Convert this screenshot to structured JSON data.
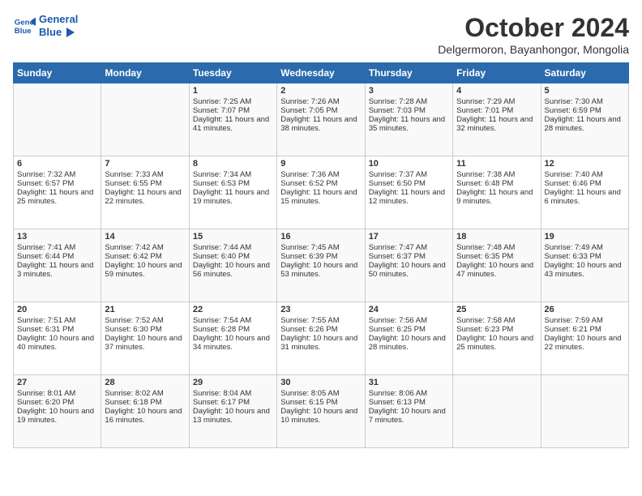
{
  "header": {
    "logo_line1": "General",
    "logo_line2": "Blue",
    "title": "October 2024",
    "location": "Delgermoron, Bayanhongor, Mongolia"
  },
  "weekdays": [
    "Sunday",
    "Monday",
    "Tuesday",
    "Wednesday",
    "Thursday",
    "Friday",
    "Saturday"
  ],
  "weeks": [
    [
      {
        "day": "",
        "info": ""
      },
      {
        "day": "",
        "info": ""
      },
      {
        "day": "1",
        "info": "Sunrise: 7:25 AM\nSunset: 7:07 PM\nDaylight: 11 hours and 41 minutes."
      },
      {
        "day": "2",
        "info": "Sunrise: 7:26 AM\nSunset: 7:05 PM\nDaylight: 11 hours and 38 minutes."
      },
      {
        "day": "3",
        "info": "Sunrise: 7:28 AM\nSunset: 7:03 PM\nDaylight: 11 hours and 35 minutes."
      },
      {
        "day": "4",
        "info": "Sunrise: 7:29 AM\nSunset: 7:01 PM\nDaylight: 11 hours and 32 minutes."
      },
      {
        "day": "5",
        "info": "Sunrise: 7:30 AM\nSunset: 6:59 PM\nDaylight: 11 hours and 28 minutes."
      }
    ],
    [
      {
        "day": "6",
        "info": "Sunrise: 7:32 AM\nSunset: 6:57 PM\nDaylight: 11 hours and 25 minutes."
      },
      {
        "day": "7",
        "info": "Sunrise: 7:33 AM\nSunset: 6:55 PM\nDaylight: 11 hours and 22 minutes."
      },
      {
        "day": "8",
        "info": "Sunrise: 7:34 AM\nSunset: 6:53 PM\nDaylight: 11 hours and 19 minutes."
      },
      {
        "day": "9",
        "info": "Sunrise: 7:36 AM\nSunset: 6:52 PM\nDaylight: 11 hours and 15 minutes."
      },
      {
        "day": "10",
        "info": "Sunrise: 7:37 AM\nSunset: 6:50 PM\nDaylight: 11 hours and 12 minutes."
      },
      {
        "day": "11",
        "info": "Sunrise: 7:38 AM\nSunset: 6:48 PM\nDaylight: 11 hours and 9 minutes."
      },
      {
        "day": "12",
        "info": "Sunrise: 7:40 AM\nSunset: 6:46 PM\nDaylight: 11 hours and 6 minutes."
      }
    ],
    [
      {
        "day": "13",
        "info": "Sunrise: 7:41 AM\nSunset: 6:44 PM\nDaylight: 11 hours and 3 minutes."
      },
      {
        "day": "14",
        "info": "Sunrise: 7:42 AM\nSunset: 6:42 PM\nDaylight: 10 hours and 59 minutes."
      },
      {
        "day": "15",
        "info": "Sunrise: 7:44 AM\nSunset: 6:40 PM\nDaylight: 10 hours and 56 minutes."
      },
      {
        "day": "16",
        "info": "Sunrise: 7:45 AM\nSunset: 6:39 PM\nDaylight: 10 hours and 53 minutes."
      },
      {
        "day": "17",
        "info": "Sunrise: 7:47 AM\nSunset: 6:37 PM\nDaylight: 10 hours and 50 minutes."
      },
      {
        "day": "18",
        "info": "Sunrise: 7:48 AM\nSunset: 6:35 PM\nDaylight: 10 hours and 47 minutes."
      },
      {
        "day": "19",
        "info": "Sunrise: 7:49 AM\nSunset: 6:33 PM\nDaylight: 10 hours and 43 minutes."
      }
    ],
    [
      {
        "day": "20",
        "info": "Sunrise: 7:51 AM\nSunset: 6:31 PM\nDaylight: 10 hours and 40 minutes."
      },
      {
        "day": "21",
        "info": "Sunrise: 7:52 AM\nSunset: 6:30 PM\nDaylight: 10 hours and 37 minutes."
      },
      {
        "day": "22",
        "info": "Sunrise: 7:54 AM\nSunset: 6:28 PM\nDaylight: 10 hours and 34 minutes."
      },
      {
        "day": "23",
        "info": "Sunrise: 7:55 AM\nSunset: 6:26 PM\nDaylight: 10 hours and 31 minutes."
      },
      {
        "day": "24",
        "info": "Sunrise: 7:56 AM\nSunset: 6:25 PM\nDaylight: 10 hours and 28 minutes."
      },
      {
        "day": "25",
        "info": "Sunrise: 7:58 AM\nSunset: 6:23 PM\nDaylight: 10 hours and 25 minutes."
      },
      {
        "day": "26",
        "info": "Sunrise: 7:59 AM\nSunset: 6:21 PM\nDaylight: 10 hours and 22 minutes."
      }
    ],
    [
      {
        "day": "27",
        "info": "Sunrise: 8:01 AM\nSunset: 6:20 PM\nDaylight: 10 hours and 19 minutes."
      },
      {
        "day": "28",
        "info": "Sunrise: 8:02 AM\nSunset: 6:18 PM\nDaylight: 10 hours and 16 minutes."
      },
      {
        "day": "29",
        "info": "Sunrise: 8:04 AM\nSunset: 6:17 PM\nDaylight: 10 hours and 13 minutes."
      },
      {
        "day": "30",
        "info": "Sunrise: 8:05 AM\nSunset: 6:15 PM\nDaylight: 10 hours and 10 minutes."
      },
      {
        "day": "31",
        "info": "Sunrise: 8:06 AM\nSunset: 6:13 PM\nDaylight: 10 hours and 7 minutes."
      },
      {
        "day": "",
        "info": ""
      },
      {
        "day": "",
        "info": ""
      }
    ]
  ]
}
